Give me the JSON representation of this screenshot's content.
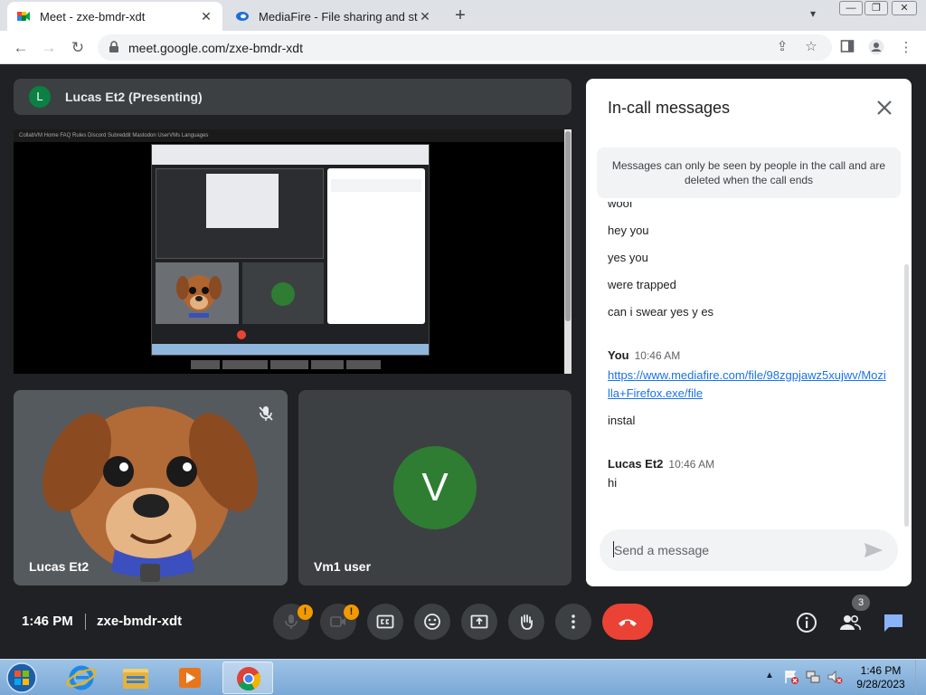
{
  "browser": {
    "tabs": [
      {
        "title": "Meet - zxe-bmdr-xdt",
        "active": true
      },
      {
        "title": "MediaFire - File sharing and storage",
        "active": false
      }
    ],
    "url": "meet.google.com/zxe-bmdr-xdt"
  },
  "presenter": {
    "avatar_letter": "L",
    "label": "Lucas Et2 (Presenting)"
  },
  "shared_screen": {
    "top_bar_text": "CollabVM  Home  FAQ  Rules  Discord  Subreddit  Mastodon  UserVMs  Languages"
  },
  "tiles": [
    {
      "name": "Lucas Et2"
    },
    {
      "name": "Vm1 user",
      "avatar_letter": "V"
    }
  ],
  "chat": {
    "title": "In-call messages",
    "notice": "Messages can only be seen by people in the call and are deleted when the call ends",
    "partial_message": "woof",
    "messages_top": [
      "hey you",
      "yes you",
      "were trapped",
      "can i swear yes y es"
    ],
    "groups": [
      {
        "sender": "You",
        "time": "10:46 AM",
        "link": "https://www.mediafire.com/file/98zgpjawz5xujwv/Mozilla+Firefox.exe/file",
        "text": "instal"
      },
      {
        "sender": "Lucas Et2",
        "time": "10:46 AM",
        "text": "hi"
      }
    ],
    "input_placeholder": "Send a message"
  },
  "meeting": {
    "time": "1:46 PM",
    "code": "zxe-bmdr-xdt",
    "participant_count": "3",
    "mic_warning": "!",
    "cam_warning": "!"
  },
  "taskbar": {
    "clock_time": "1:46 PM",
    "clock_date": "9/28/2023"
  },
  "colors": {
    "meet_bg": "#202124",
    "hangup": "#ea4335",
    "link": "#1a73e8",
    "chat_icon": "#1a73e8",
    "warning": "#f29900"
  }
}
